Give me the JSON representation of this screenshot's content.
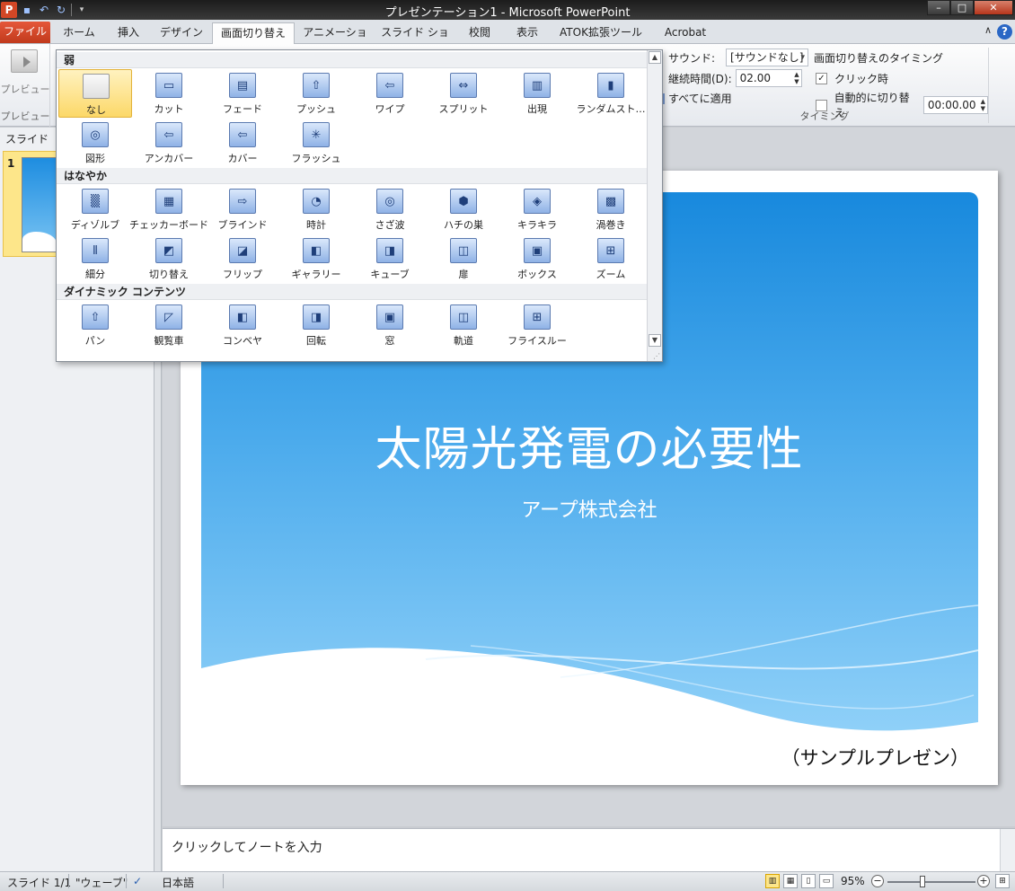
{
  "app": {
    "title": "プレゼンテーション1 - Microsoft PowerPoint",
    "logo": "P",
    "window_buttons": [
      "–",
      "□",
      "✕"
    ]
  },
  "tabs": {
    "file": "ファイル",
    "items": [
      "ホーム",
      "挿入",
      "デザイン",
      "画面切り替え",
      "アニメーション",
      "スライド ショー",
      "校閲",
      "表示",
      "ATOK拡張ツール",
      "Acrobat"
    ],
    "active_index": 3,
    "help": "?",
    "minimize": "∧"
  },
  "ribbon": {
    "preview_label": "プレビュー",
    "preview_group": "プレビュー",
    "sound_label": "サウンド:",
    "sound_value": "[サウンドなし]",
    "duration_label": "継続時間(D):",
    "duration_value": "02.00",
    "apply_all": "すべてに適用",
    "timing_heading": "画面切り替えのタイミング",
    "on_click": "クリック時",
    "on_click_checked": true,
    "after_label": "自動的に切り替え",
    "after_checked": false,
    "after_value": "00:00.00",
    "timing_group": "タイミング"
  },
  "gallery": {
    "sections": [
      {
        "name": "弱",
        "items": [
          {
            "label": "なし",
            "icon": "none-icon",
            "glyph": ""
          },
          {
            "label": "カット",
            "icon": "cut-icon",
            "glyph": "▭"
          },
          {
            "label": "フェード",
            "icon": "fade-icon",
            "glyph": "▤"
          },
          {
            "label": "プッシュ",
            "icon": "push-icon",
            "glyph": "⇧"
          },
          {
            "label": "ワイプ",
            "icon": "wipe-icon",
            "glyph": "⇦"
          },
          {
            "label": "スプリット",
            "icon": "split-icon",
            "glyph": "⇔"
          },
          {
            "label": "出現",
            "icon": "reveal-icon",
            "glyph": "▥"
          },
          {
            "label": "ランダムスト…",
            "icon": "random-bars-icon",
            "glyph": "▮"
          },
          {
            "label": "図形",
            "icon": "shape-icon",
            "glyph": "◎"
          },
          {
            "label": "アンカバー",
            "icon": "uncover-icon",
            "glyph": "⇦"
          },
          {
            "label": "カバー",
            "icon": "cover-icon",
            "glyph": "⇦"
          },
          {
            "label": "フラッシュ",
            "icon": "flash-icon",
            "glyph": "✳"
          }
        ]
      },
      {
        "name": "はなやか",
        "items": [
          {
            "label": "ディゾルブ",
            "icon": "dissolve-icon",
            "glyph": "▒"
          },
          {
            "label": "チェッカーボード",
            "icon": "checkerboard-icon",
            "glyph": "▦"
          },
          {
            "label": "ブラインド",
            "icon": "blinds-icon",
            "glyph": "⇨"
          },
          {
            "label": "時計",
            "icon": "clock-icon",
            "glyph": "◔"
          },
          {
            "label": "さざ波",
            "icon": "ripple-icon",
            "glyph": "◎"
          },
          {
            "label": "ハチの巣",
            "icon": "honeycomb-icon",
            "glyph": "⬢"
          },
          {
            "label": "キラキラ",
            "icon": "glitter-icon",
            "glyph": "◈"
          },
          {
            "label": "渦巻き",
            "icon": "vortex-icon",
            "glyph": "▩"
          },
          {
            "label": "細分",
            "icon": "shred-icon",
            "glyph": "⦀"
          },
          {
            "label": "切り替え",
            "icon": "switch-icon",
            "glyph": "◩"
          },
          {
            "label": "フリップ",
            "icon": "flip-icon",
            "glyph": "◪"
          },
          {
            "label": "ギャラリー",
            "icon": "gallery-transition-icon",
            "glyph": "◧"
          },
          {
            "label": "キューブ",
            "icon": "cube-icon",
            "glyph": "◨"
          },
          {
            "label": "扉",
            "icon": "doors-icon",
            "glyph": "◫"
          },
          {
            "label": "ボックス",
            "icon": "box-icon",
            "glyph": "▣"
          },
          {
            "label": "ズーム",
            "icon": "zoom-transition-icon",
            "glyph": "⊞"
          }
        ]
      },
      {
        "name": "ダイナミック コンテンツ",
        "items": [
          {
            "label": "パン",
            "icon": "pan-icon",
            "glyph": "⇧"
          },
          {
            "label": "観覧車",
            "icon": "ferris-wheel-icon",
            "glyph": "◸"
          },
          {
            "label": "コンベヤ",
            "icon": "conveyor-icon",
            "glyph": "◧"
          },
          {
            "label": "回転",
            "icon": "rotate-icon",
            "glyph": "◨"
          },
          {
            "label": "窓",
            "icon": "window-icon",
            "glyph": "▣"
          },
          {
            "label": "軌道",
            "icon": "orbit-icon",
            "glyph": "◫"
          },
          {
            "label": "フライスルー",
            "icon": "fly-through-icon",
            "glyph": "⊞"
          }
        ]
      }
    ]
  },
  "slides_pane": {
    "tab_label": "スライド",
    "thumb_number": "1"
  },
  "slide": {
    "title": "太陽光発電の必要性",
    "subtitle": "アープ株式会社",
    "footer": "（サンプルプレゼン）"
  },
  "notes": {
    "placeholder": "クリックしてノートを入力"
  },
  "status": {
    "slide": "スライド 1/1",
    "theme": "\"ウェーブ\"",
    "language": "日本語",
    "zoom": "95%",
    "zoom_fraction": 0.4
  }
}
